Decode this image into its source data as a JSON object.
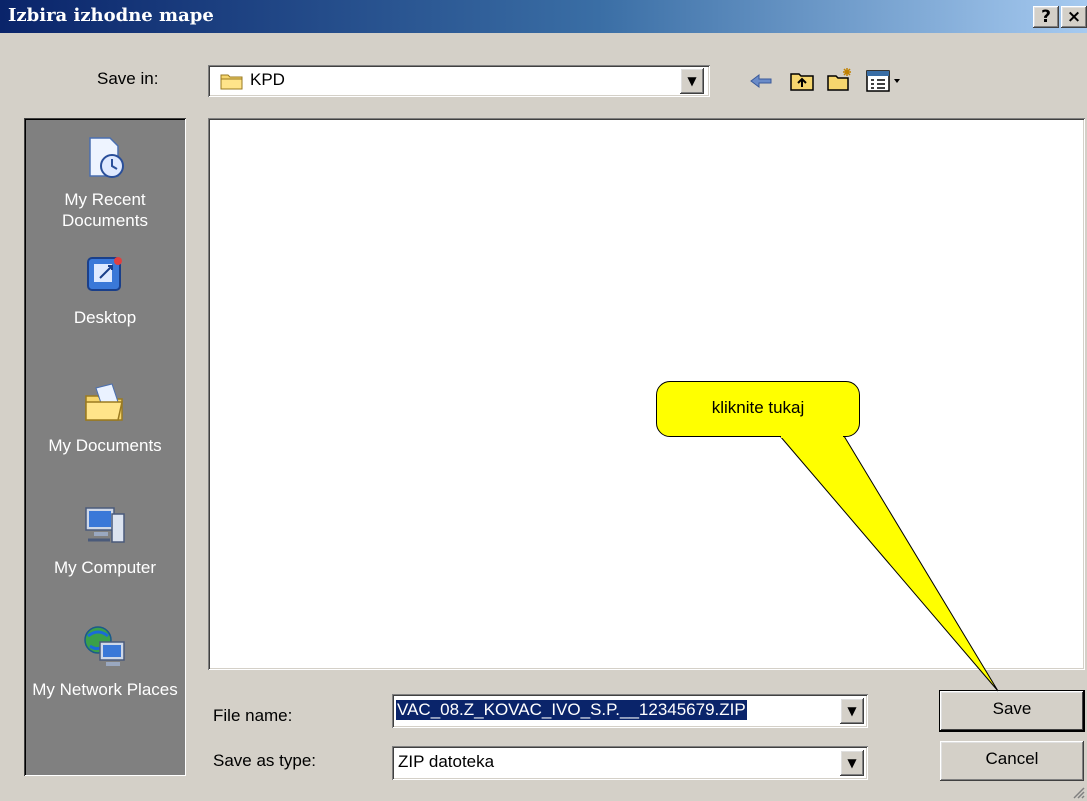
{
  "window": {
    "title": "Izbira izhodne mape",
    "help_label": "?",
    "close_label": "×"
  },
  "toolbar": {
    "save_in_label": "Save in:",
    "current_folder": "KPD",
    "icons": [
      "back-arrow-icon",
      "up-folder-icon",
      "new-folder-icon",
      "view-menu-icon"
    ]
  },
  "places": [
    {
      "label": "My Recent Documents",
      "icon": "recent-documents-icon"
    },
    {
      "label": "Desktop",
      "icon": "desktop-icon"
    },
    {
      "label": "My Documents",
      "icon": "my-documents-icon"
    },
    {
      "label": "My Computer",
      "icon": "my-computer-icon"
    },
    {
      "label": "My Network Places",
      "icon": "network-places-icon"
    }
  ],
  "file_name": {
    "label": "File name:",
    "value": "VAC_08.Z_KOVAC_IVO_S.P.__12345679.ZIP"
  },
  "save_as_type": {
    "label": "Save as type:",
    "value": "ZIP datoteka"
  },
  "buttons": {
    "save": "Save",
    "cancel": "Cancel"
  },
  "callout": {
    "text": "kliknite tukaj",
    "color": "#ffff00"
  },
  "colors": {
    "title_start": "#0a246a",
    "title_end": "#a6caf0",
    "dialog_bg": "#d4d0c8",
    "places_bg": "#808080",
    "selection": "#0a246a"
  }
}
